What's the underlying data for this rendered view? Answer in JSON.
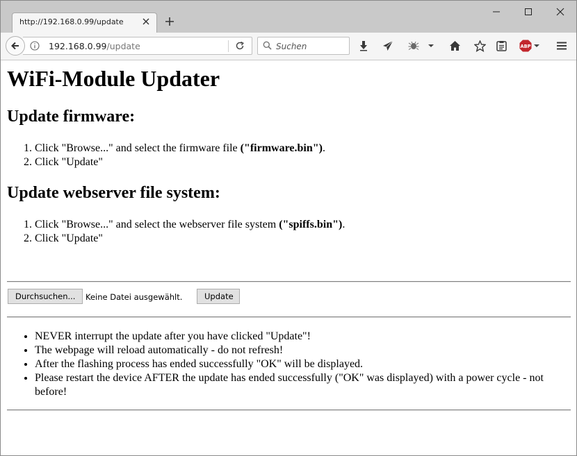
{
  "browser": {
    "tab_title": "http://192.168.0.99/update",
    "url_host": "192.168.0.99",
    "url_path": "/update",
    "search_placeholder": "Suchen",
    "abp_badge": "ABP",
    "accent_abp": "#c2272d"
  },
  "page": {
    "title": "WiFi-Module Updater",
    "firmware": {
      "heading": "Update firmware:",
      "step1_text": "Click \"Browse...\" and select the firmware file ",
      "step1_bold": "(\"firmware.bin\")",
      "step1_end": ".",
      "step2": "Click \"Update\""
    },
    "spiffs": {
      "heading": "Update webserver file system:",
      "step1_text": "Click \"Browse...\" and select the webserver file system ",
      "step1_bold": "(\"spiffs.bin\")",
      "step1_end": ".",
      "step2": "Click \"Update\""
    },
    "form": {
      "browse_label": "Durchsuchen...",
      "file_status": "Keine Datei ausgewählt.",
      "update_label": "Update"
    },
    "notes": [
      "NEVER interrupt the update after you have clicked \"Update\"!",
      "The webpage will reload automatically - do not refresh!",
      "After the flashing process has ended successfully \"OK\" will be displayed.",
      "Please restart the device AFTER the update has ended successfully (\"OK\" was displayed) with a power cycle - not before!"
    ]
  }
}
